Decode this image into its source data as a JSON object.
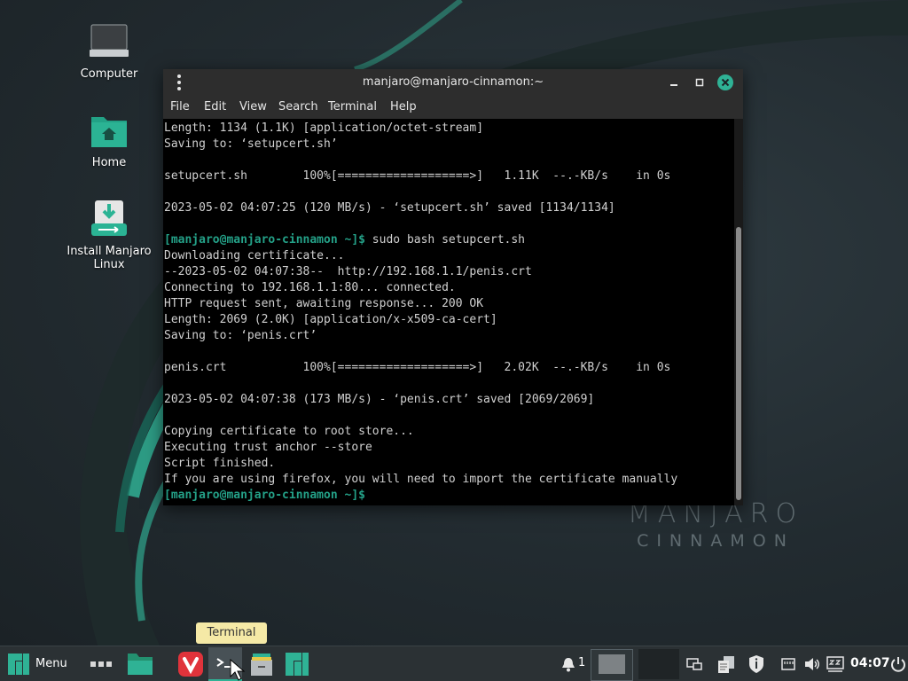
{
  "desktop": {
    "icons": [
      {
        "label": "Computer",
        "icon": "monitor-icon"
      },
      {
        "label": "Home",
        "icon": "home-folder-icon"
      },
      {
        "label": "Install Manjaro Linux",
        "icon": "install-icon"
      }
    ],
    "wallpaper_brand_line1": "MANJARO",
    "wallpaper_brand_line2": "CINNAMON",
    "accent_color": "#24a188"
  },
  "terminal": {
    "title": "manjaro@manjaro-cinnamon:~",
    "menu": [
      "File",
      "Edit",
      "View",
      "Search",
      "Terminal",
      "Help"
    ],
    "lines": [
      {
        "text": "Length: 1134 (1.1K) [application/octet-stream]"
      },
      {
        "text": "Saving to: ‘setupcert.sh’"
      },
      {
        "text": ""
      },
      {
        "text": "setupcert.sh        100%[===================>]   1.11K  --.-KB/s    in 0s"
      },
      {
        "text": ""
      },
      {
        "text": "2023-05-02 04:07:25 (120 MB/s) - ‘setupcert.sh’ saved [1134/1134]"
      },
      {
        "text": ""
      },
      {
        "prompt": "[manjaro@manjaro-cinnamon ~]$",
        "text": " sudo bash setupcert.sh"
      },
      {
        "text": "Downloading certificate..."
      },
      {
        "text": "--2023-05-02 04:07:38--  http://192.168.1.1/penis.crt"
      },
      {
        "text": "Connecting to 192.168.1.1:80... connected."
      },
      {
        "text": "HTTP request sent, awaiting response... 200 OK"
      },
      {
        "text": "Length: 2069 (2.0K) [application/x-x509-ca-cert]"
      },
      {
        "text": "Saving to: ‘penis.crt’"
      },
      {
        "text": ""
      },
      {
        "text": "penis.crt           100%[===================>]   2.02K  --.-KB/s    in 0s"
      },
      {
        "text": ""
      },
      {
        "text": "2023-05-02 04:07:38 (173 MB/s) - ‘penis.crt’ saved [2069/2069]"
      },
      {
        "text": ""
      },
      {
        "text": "Copying certificate to root store..."
      },
      {
        "text": "Executing trust anchor --store"
      },
      {
        "text": "Script finished."
      },
      {
        "text": "If you are using firefox, you will need to import the certificate manually"
      },
      {
        "prompt": "[manjaro@manjaro-cinnamon ~]$",
        "text": ""
      }
    ]
  },
  "tooltip": {
    "text": "Terminal"
  },
  "panel": {
    "menu_label": "Menu",
    "notification_count": "1",
    "clock": "04:07"
  }
}
